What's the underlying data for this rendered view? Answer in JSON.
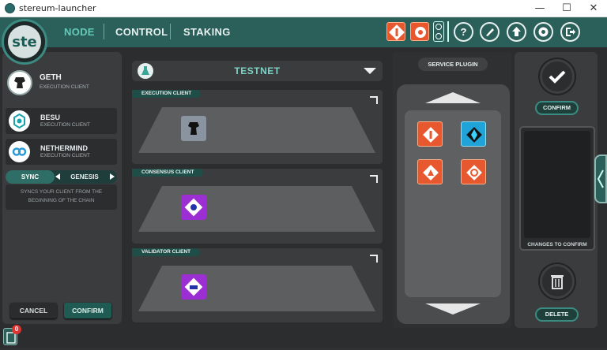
{
  "window": {
    "title": "stereum-launcher",
    "minimize": "—",
    "maximize": "☐",
    "close": "✕"
  },
  "header": {
    "logo_text": "ste",
    "tabs": [
      {
        "label": "NODE",
        "active": true
      },
      {
        "label": "CONTROL",
        "active": false
      },
      {
        "label": "STAKING",
        "active": false
      }
    ],
    "help_label": "?"
  },
  "sidebar": {
    "selected_client": {
      "name": "GETH",
      "type": "EXECUTION CLIENT"
    },
    "clients": [
      {
        "name": "BESU",
        "type": "EXECUTION CLIENT"
      },
      {
        "name": "NETHERMIND",
        "type": "EXECUTION CLIENT"
      }
    ],
    "sync": {
      "options": [
        "SYNC",
        "GENESIS"
      ],
      "description": "SYNCS YOUR CLIENT FROM THE BEGINNING OF THE CHAIN"
    },
    "cancel_label": "CANCEL",
    "confirm_label": "CONFIRM"
  },
  "main": {
    "network": "TESTNET",
    "panels": [
      {
        "label": "EXECUTION CLIENT"
      },
      {
        "label": "CONSENSUS CLIENT"
      },
      {
        "label": "VALIDATOR CLIENT"
      }
    ]
  },
  "service_plugin": {
    "title": "SERVICE PLUGIN"
  },
  "right": {
    "confirm_label": "CONFIRM",
    "changes_label": "CHANGES TO CONFIRM",
    "delete_label": "DELETE"
  },
  "notifications": {
    "count": "0"
  },
  "colors": {
    "accent": "#2a5f5a",
    "accent_light": "#67c8b8",
    "orange": "#e8582e",
    "purple": "#9c2fd4"
  }
}
